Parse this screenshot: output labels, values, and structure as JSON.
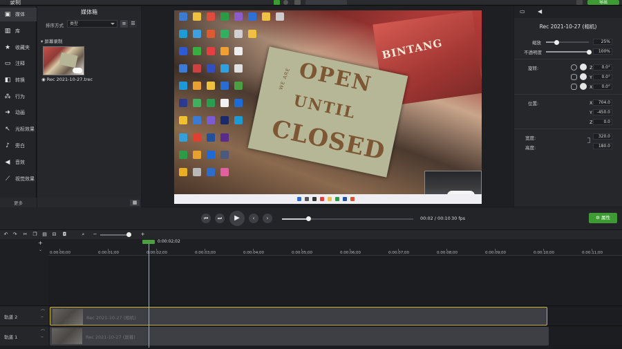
{
  "app": {
    "title": "录制",
    "export_label": "导出"
  },
  "sidebar": {
    "items": [
      {
        "label": "媒体",
        "icon": "media-icon"
      },
      {
        "label": "库",
        "icon": "library-icon"
      },
      {
        "label": "收藏夹",
        "icon": "star-icon"
      },
      {
        "label": "注释",
        "icon": "annotation-icon"
      },
      {
        "label": "转换",
        "icon": "transition-icon"
      },
      {
        "label": "行为",
        "icon": "behavior-icon"
      },
      {
        "label": "动画",
        "icon": "animation-icon"
      },
      {
        "label": "光标效果",
        "icon": "cursor-effect-icon"
      },
      {
        "label": "旁白",
        "icon": "microphone-icon"
      },
      {
        "label": "音效",
        "icon": "speaker-icon"
      },
      {
        "label": "视觉效果",
        "icon": "magic-wand-icon"
      }
    ],
    "more_label": "更多"
  },
  "media_bin": {
    "title": "媒体箱",
    "sort_label": "排序方式",
    "sort_value": "类型",
    "group_label": "屏幕录制",
    "item_label": "Rec 2021-10-27.trec"
  },
  "canvas": {
    "sign_small": "WE ARE",
    "sign_line1": "OPEN",
    "sign_line2": "UNTIL",
    "sign_line3": "CLOSED",
    "poster_text": "BINTANG"
  },
  "properties": {
    "title": "Rec 2021-10-27 (相机)",
    "scale_label": "缩放",
    "scale_value": "25%",
    "scale_fraction": 0.25,
    "opacity_label": "不透明度",
    "opacity_value": "100%",
    "opacity_fraction": 1.0,
    "rotation_label": "旋转:",
    "rotation": [
      {
        "axis": "Z",
        "value": "0.0°"
      },
      {
        "axis": "Y",
        "value": "0.0°"
      },
      {
        "axis": "X",
        "value": "0.0°"
      }
    ],
    "position_label": "位置:",
    "position": [
      {
        "axis": "X",
        "value": "704.0"
      },
      {
        "axis": "Y",
        "value": "-450.0"
      },
      {
        "axis": "Z",
        "value": "0.0"
      }
    ],
    "width_label": "宽度:",
    "width_value": "320.0",
    "height_label": "高度:",
    "height_value": "180.0"
  },
  "playback": {
    "timecode": "00:02 / 00:10",
    "fps": "30 fps",
    "progress_fraction": 0.2,
    "properties_button": "属性"
  },
  "timeline": {
    "playhead_time": "0:00:02;02",
    "ticks": [
      "0:00:00;00",
      "0:00:01;00",
      "0:00:02;00",
      "0:00:03;00",
      "0:00:04;00",
      "0:00:05;00",
      "0:00:06;00",
      "0:00:07;00",
      "0:00:08;00",
      "0:00:09;00",
      "0:00:10;00",
      "0:00:11;00"
    ],
    "tracks": [
      {
        "name": "轨道 2",
        "clip_label": "Rec 2021-10-27 (相机)"
      },
      {
        "name": "轨道 1",
        "clip_label": "Rec 2021-10-27 (屏幕)"
      }
    ]
  },
  "colors": {
    "accent_green": "#3e9b34",
    "selected_clip_border": "#c9b33a"
  }
}
